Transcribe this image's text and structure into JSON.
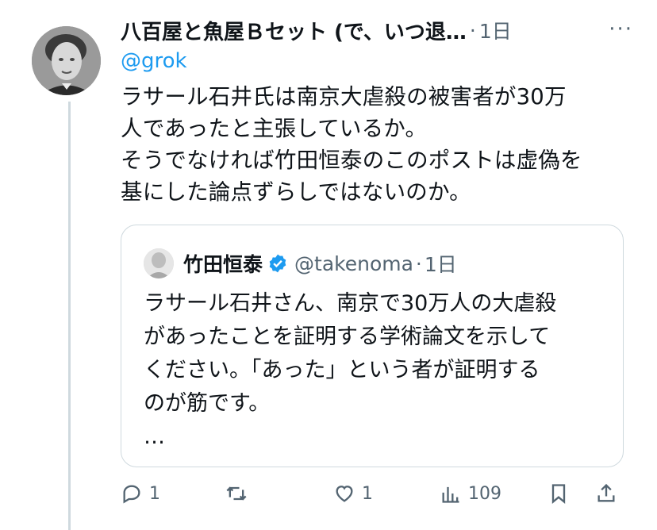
{
  "tweet": {
    "author_name": "八百屋と魚屋Ｂセット (で、いつ退…",
    "separator": "·",
    "time": "1日",
    "more": "···",
    "reply_to": "@grok",
    "body": "ラサール石井氏は南京大虐殺の被害者が30万\n人であったと主張しているか。\nそうでなければ竹田恒泰のこのポストは虚偽を\n基にした論点ずらしではないのか。"
  },
  "quote": {
    "name": "竹田恒泰",
    "handle": "@takenoma",
    "separator": "·",
    "time": "1日",
    "text": "ラサール石井さん、南京で30万人の大虐殺\nがあったことを証明する学術論文を示して\nください。「あった」という者が証明する\nのが筋です。\n…"
  },
  "actions": {
    "reply_count": "1",
    "retweet_count": "",
    "like_count": "1",
    "views_count": "109"
  },
  "icons": [
    "reply-icon",
    "retweet-icon",
    "like-icon",
    "views-icon",
    "bookmark-icon",
    "share-icon",
    "verified-badge-icon"
  ],
  "colors": {
    "accent": "#1d9bf0",
    "muted": "#536471",
    "border": "#cfd9de"
  }
}
